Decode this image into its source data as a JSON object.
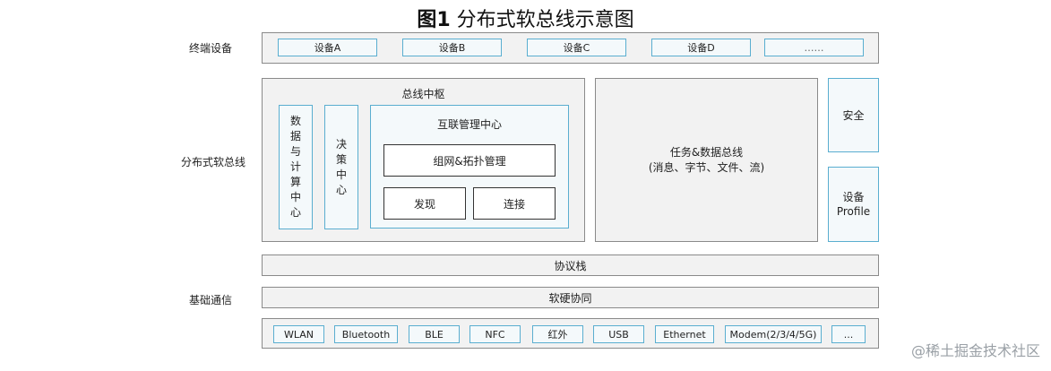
{
  "title": {
    "prefix": "图1",
    "text": " 分布式软总线示意图"
  },
  "side_labels": {
    "terminal": "终端设备",
    "softbus": "分布式软总线",
    "basic_comm": "基础通信"
  },
  "devices": [
    "设备A",
    "设备B",
    "设备C",
    "设备D",
    "……"
  ],
  "bus_hub": {
    "title": "总线中枢",
    "data_center": [
      "数",
      "据",
      "与",
      "计",
      "算",
      "中",
      "心"
    ],
    "decision_center": [
      "决",
      "策",
      "中",
      "心"
    ],
    "interconnect": {
      "title": "互联管理中心",
      "network": "组网&拓扑管理",
      "discover": "发现",
      "connect": "连接"
    }
  },
  "task_bus": {
    "line1": "任务&数据总线",
    "line2": "(消息、字节、文件、流)"
  },
  "security": "安全",
  "device_profile": [
    "设备",
    "Profile"
  ],
  "protocol_stack": "协议栈",
  "hw_sw": "软硬协同",
  "protocols": [
    "WLAN",
    "Bluetooth",
    "BLE",
    "NFC",
    "红外",
    "USB",
    "Ethernet",
    "Modem(2/3/4/5G)",
    "..."
  ],
  "watermark": "@稀土掘金技术社区"
}
